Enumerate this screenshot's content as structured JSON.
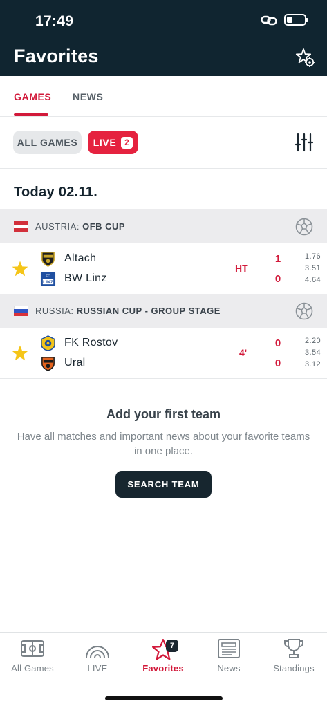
{
  "status_bar": {
    "time": "17:49",
    "battery_level": 0.35
  },
  "header": {
    "title": "Favorites"
  },
  "tabs": [
    {
      "label": "GAMES",
      "active": true
    },
    {
      "label": "NEWS",
      "active": false
    }
  ],
  "filters": {
    "all_label": "ALL GAMES",
    "live_label": "LIVE",
    "live_count": "2"
  },
  "date_heading": "Today 02.11.",
  "leagues": [
    {
      "country": "AUSTRIA:",
      "name": "OFB CUP",
      "flag_colors": [
        "#d2303b",
        "#ffffff",
        "#d2303b"
      ],
      "match": {
        "home": "Altach",
        "away": "BW Linz",
        "status": "HT",
        "home_score": "1",
        "away_score": "0",
        "odds": [
          "1.76",
          "3.51",
          "4.64"
        ],
        "favorite": true
      }
    },
    {
      "country": "RUSSIA:",
      "name": "RUSSIAN CUP - GROUP STAGE",
      "flag_colors": [
        "#ffffff",
        "#2f55c4",
        "#d9323a"
      ],
      "match": {
        "home": "FK Rostov",
        "away": "Ural",
        "status": "4'",
        "home_score": "0",
        "away_score": "0",
        "odds": [
          "2.20",
          "3.54",
          "3.12"
        ],
        "favorite": true
      }
    }
  ],
  "empty_state": {
    "title": "Add your first team",
    "description": "Have all matches and important news about your favorite teams in one place.",
    "button_label": "SEARCH TEAM"
  },
  "bottom_nav": [
    {
      "label": "All Games",
      "icon": "pitch-icon"
    },
    {
      "label": "LIVE",
      "icon": "live-signal-icon"
    },
    {
      "label": "Favorites",
      "icon": "star-icon",
      "badge": "7",
      "active": true
    },
    {
      "label": "News",
      "icon": "newspaper-icon"
    },
    {
      "label": "Standings",
      "icon": "trophy-icon"
    }
  ],
  "colors": {
    "accent": "#d2193a",
    "header_bg": "#102530",
    "star": "#f5c518"
  }
}
